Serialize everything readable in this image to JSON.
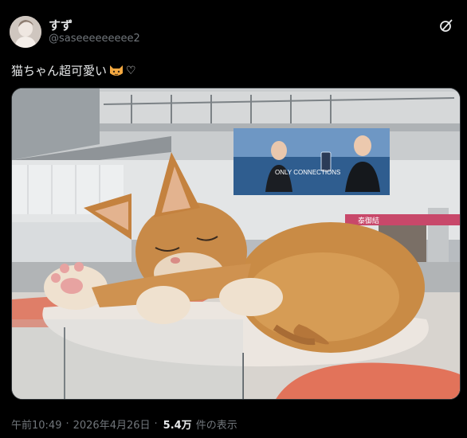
{
  "author": {
    "display_name": "すず",
    "handle": "@saseeeeeeeee2"
  },
  "tweet": {
    "text": "猫ちゃん超可愛い",
    "heart": "♡"
  },
  "media": {
    "billboard_text": "ONLY CONNECTIONS",
    "store_sign": "泰御結"
  },
  "meta": {
    "time": "午前10:49",
    "separator": "·",
    "date": "2026年4月26日",
    "views_count": "5.4万",
    "views_label": "件の表示"
  },
  "icons": {
    "grok": "grok-icon",
    "avatar": "avatar-image",
    "emoji": "cat-face-emoji"
  }
}
